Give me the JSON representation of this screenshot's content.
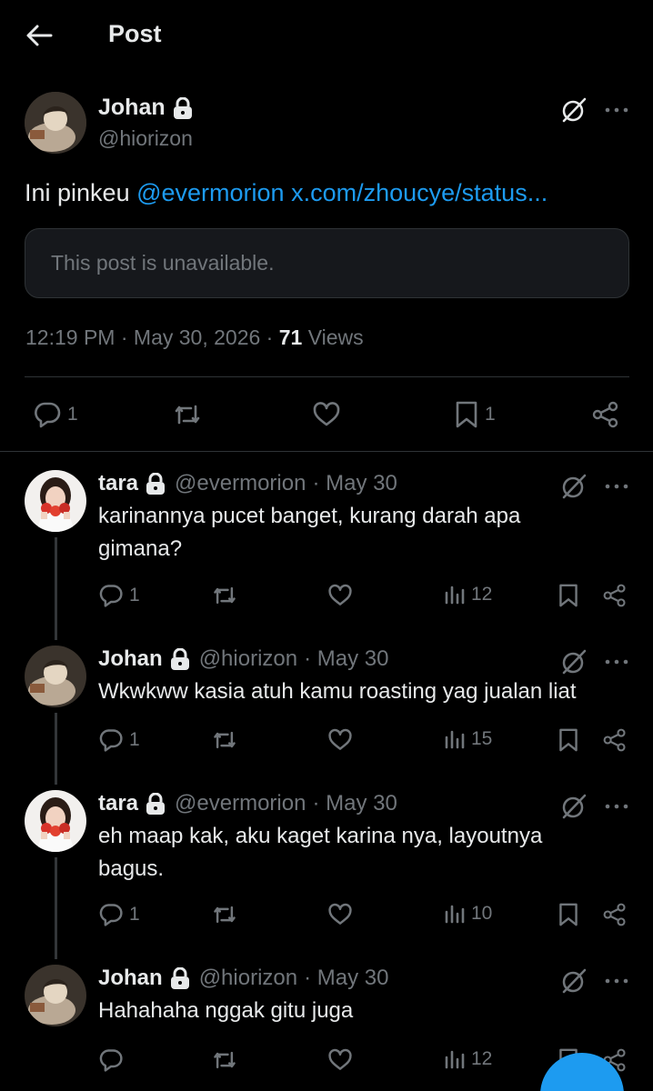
{
  "header": {
    "title": "Post"
  },
  "post": {
    "author_name": "Johan",
    "author_handle": "@hiorizon",
    "text_prefix": "Ini pinkeu ",
    "mention": "@evermorion",
    "link": "x.com/zhoucye/status...",
    "unavailable_text": "This post is unavailable.",
    "time": "12:19 PM",
    "sep1": " · ",
    "date": "May 30, 2026",
    "sep2": " · ",
    "views_count": "71",
    "views_label": " Views",
    "reply_count": "1",
    "bookmark_count": "1"
  },
  "replies": [
    {
      "name": "tara",
      "handle": "@evermorion",
      "date": "· May 30",
      "text": "karinannya pucet banget, kurang darah apa gimana?",
      "reply_count": "1",
      "views": "12",
      "avatar": "tara"
    },
    {
      "name": "Johan",
      "handle": "@hiorizon",
      "date": "· May 30",
      "text": "Wkwkww kasia atuh kamu roasting yag jualan liat",
      "reply_count": "1",
      "views": "15",
      "avatar": "johan"
    },
    {
      "name": "tara",
      "handle": "@evermorion",
      "date": "· May 30",
      "text": "eh maap kak, aku kaget karina nya, layoutnya bagus.",
      "reply_count": "1",
      "views": "10",
      "avatar": "tara"
    },
    {
      "name": "Johan",
      "handle": "@hiorizon",
      "date": "· May 30",
      "text": "Hahahaha nggak gitu juga",
      "reply_count": "",
      "views": "12",
      "avatar": "johan"
    }
  ],
  "colors": {
    "accent": "#1d9bf0",
    "muted": "#71767b",
    "text": "#e7e9ea",
    "border": "#2f3336"
  }
}
